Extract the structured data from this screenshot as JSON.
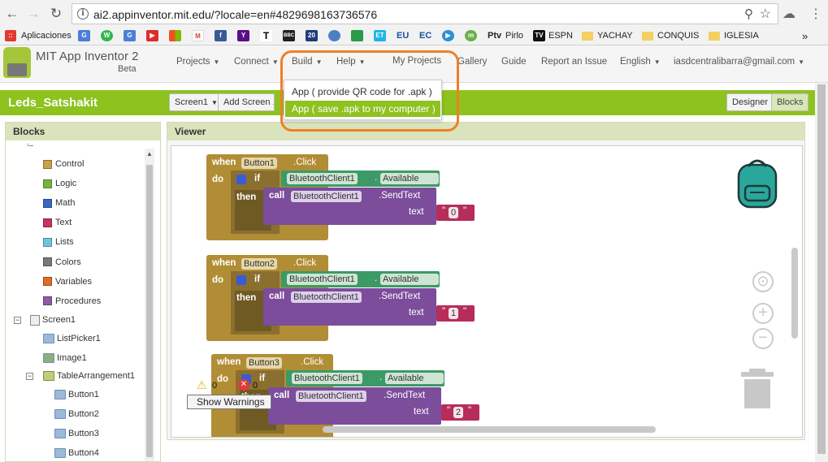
{
  "browser": {
    "url": "ai2.appinventor.mit.edu/?locale=en#4829698163736576",
    "bookmarks": [
      "Aplicaciones",
      "EU",
      "EC",
      "Ptv",
      "Pirlo",
      "ESPN",
      "YACHAY",
      "CONQUIS",
      "IGLESIA"
    ],
    "more_label": "»"
  },
  "app": {
    "name": "MIT App Inventor 2",
    "beta": "Beta",
    "menus": [
      "Projects",
      "Connect",
      "Build",
      "Help",
      "My Projects",
      "Gallery",
      "Guide",
      "Report an Issue",
      "English",
      "iasdcentralibarra@gmail.com"
    ]
  },
  "build_menu": {
    "items": [
      "App ( provide QR code for .apk )",
      "App ( save .apk to my computer )"
    ],
    "selected_index": 1
  },
  "project": {
    "name": "Leds_Satshakit",
    "screen_select": "Screen1",
    "add_screen": "Add Screen ...",
    "designer": "Designer",
    "blocks": "Blocks"
  },
  "blocks_panel": {
    "title": "Blocks",
    "builtin_categories": [
      {
        "label": "Control",
        "color": "#c8a246"
      },
      {
        "label": "Logic",
        "color": "#73b53f"
      },
      {
        "label": "Math",
        "color": "#3a68c4"
      },
      {
        "label": "Text",
        "color": "#c6345f"
      },
      {
        "label": "Lists",
        "color": "#6fc3e0"
      },
      {
        "label": "Colors",
        "color": "#7a7a7a"
      },
      {
        "label": "Variables",
        "color": "#e06d26"
      },
      {
        "label": "Procedures",
        "color": "#8e5ba8"
      }
    ],
    "screen": "Screen1",
    "components": [
      "ListPicker1",
      "Image1",
      "TableArrangement1",
      "Button1",
      "Button2",
      "Button3",
      "Button4"
    ]
  },
  "viewer": {
    "title": "Viewer",
    "warning_count": "0",
    "error_count": "0",
    "show_warnings": "Show Warnings"
  },
  "code": [
    {
      "button": "Button1",
      "value": "0"
    },
    {
      "button": "Button2",
      "value": "1"
    },
    {
      "button": "Button3",
      "value": "2"
    }
  ],
  "code_words": {
    "when": "when",
    "click": ".Click",
    "do": "do",
    "if": "if",
    "then": "then",
    "call": "call",
    "bt": "BluetoothClient1",
    "dot": ".",
    "available": "Available",
    "sendtext": ".SendText",
    "text": "text",
    "quote": "\""
  },
  "icons": [
    "back-icon",
    "forward-icon",
    "reload-icon",
    "info-icon",
    "zoom-icon",
    "star-icon",
    "backpack-icon",
    "trash-icon",
    "target-icon",
    "zoom-in-icon",
    "zoom-out-icon",
    "warning-icon",
    "error-icon"
  ]
}
